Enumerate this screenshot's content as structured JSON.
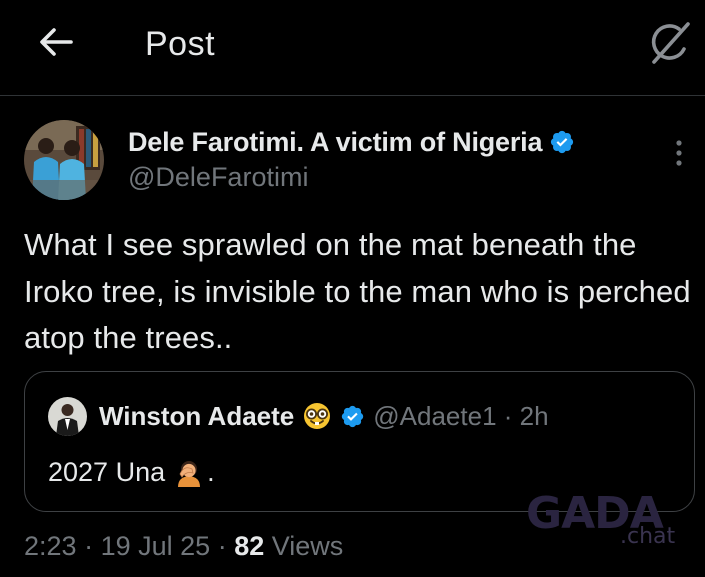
{
  "header": {
    "title": "Post",
    "back_icon": "arrow-left-icon",
    "grok_icon": "grok-icon"
  },
  "post": {
    "author": {
      "name": "Dele Farotimi. A victim of Nigeria",
      "handle": "@DeleFarotimi",
      "verified": true
    },
    "text": "What I see sprawled on the mat beneath the Iroko tree, is invisible to the man who is perched atop the trees..",
    "quote": {
      "author_name": "Winston Adaete",
      "name_emoji": "nerd-face-emoji",
      "handle_time": "@Adaete1 · 2h",
      "text": "2027 Una",
      "text_emoji": "person-facepalming-emoji",
      "text_suffix": "."
    },
    "meta": {
      "time": "2:23",
      "date": "19 Jul 25",
      "views_count": "82",
      "views_label": "Views"
    }
  },
  "watermark": {
    "brand": "GADA",
    "sub": ".chat"
  },
  "colors": {
    "background": "#000000",
    "primary_text": "#e7e9ea",
    "secondary_text": "#71767b",
    "verified_blue": "#1d9bf0",
    "border": "#2f3336"
  }
}
